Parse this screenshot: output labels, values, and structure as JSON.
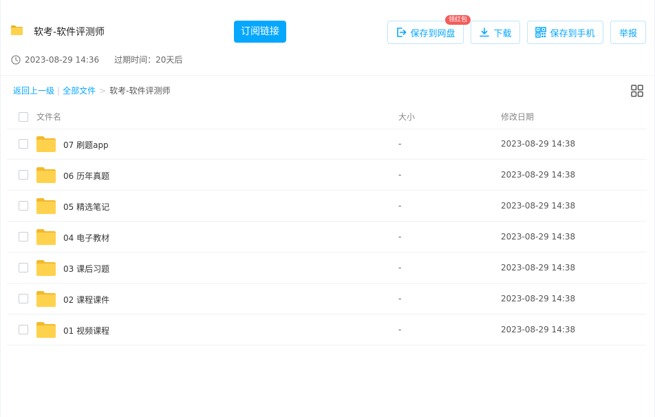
{
  "header": {
    "title": "软考-软件评测师",
    "subscribe_label": "订阅链接",
    "save_to_cloud_label": "保存到网盘",
    "badge_label": "领红包",
    "download_label": "下载",
    "save_to_phone_label": "保存到手机",
    "report_label": "举报",
    "date": "2023-08-29 14:36",
    "expire": "过期时间：20天后"
  },
  "breadcrumb": {
    "back": "返回上一级",
    "all_files": "全部文件",
    "separator": ">",
    "current": "软考-软件评测师"
  },
  "table": {
    "columns": {
      "name": "文件名",
      "size": "大小",
      "date": "修改日期"
    },
    "rows": [
      {
        "name": "07 刷题app",
        "size": "-",
        "date": "2023-08-29 14:38"
      },
      {
        "name": "06 历年真题",
        "size": "-",
        "date": "2023-08-29 14:38"
      },
      {
        "name": "05 精选笔记",
        "size": "-",
        "date": "2023-08-29 14:38"
      },
      {
        "name": "04 电子教材",
        "size": "-",
        "date": "2023-08-29 14:38"
      },
      {
        "name": "03 课后习题",
        "size": "-",
        "date": "2023-08-29 14:38"
      },
      {
        "name": "02 课程课件",
        "size": "-",
        "date": "2023-08-29 14:38"
      },
      {
        "name": "01 视频课程",
        "size": "-",
        "date": "2023-08-29 14:38"
      }
    ]
  },
  "colors": {
    "accent": "#06a7ff",
    "folder": "#ffd24d",
    "badge": "#f25d5d"
  }
}
